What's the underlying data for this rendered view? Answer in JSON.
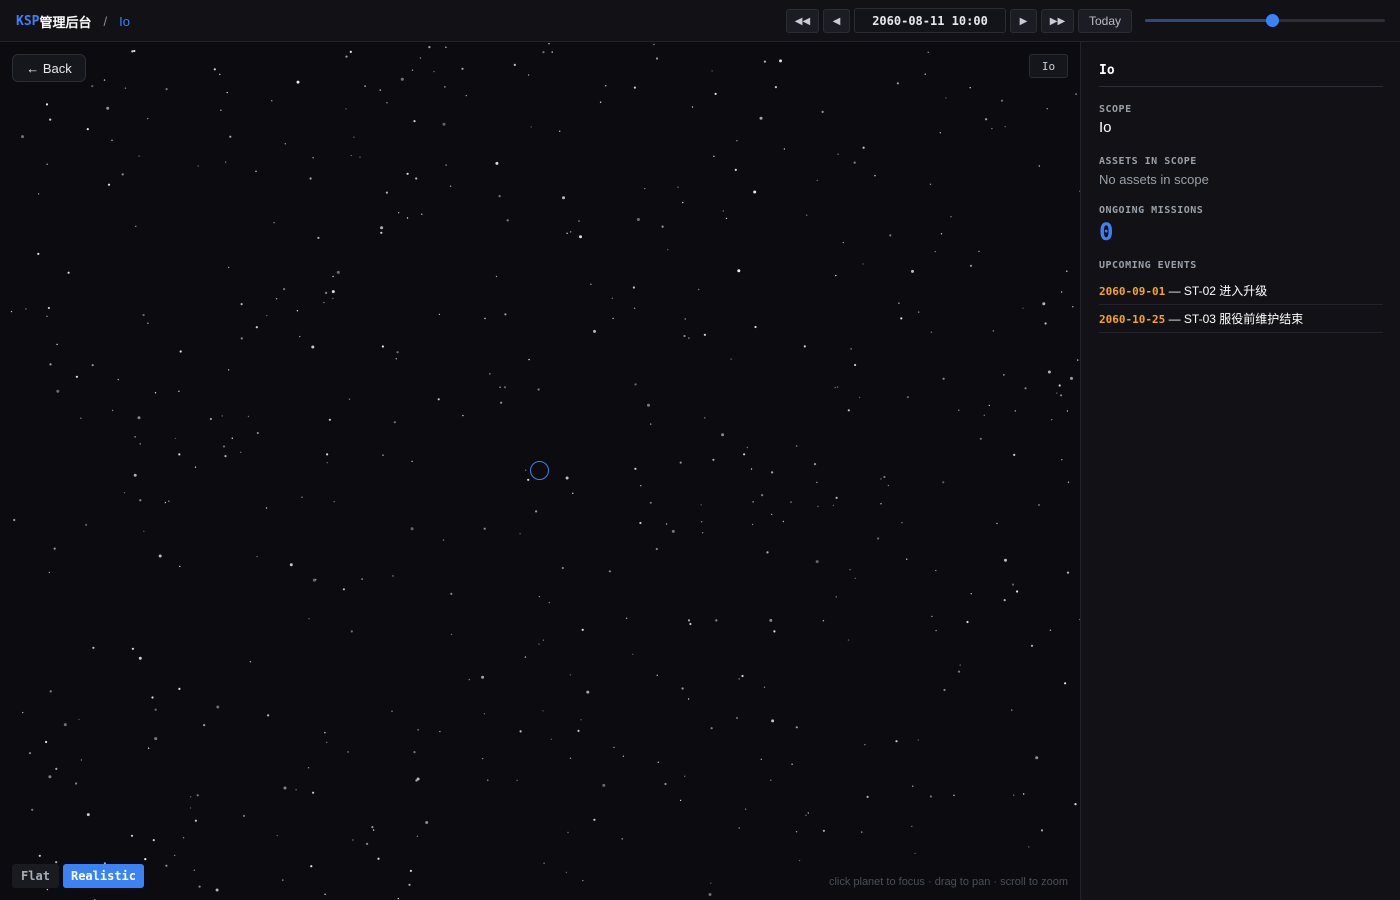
{
  "header": {
    "brand_prefix": "KSP",
    "brand_suffix": "管理后台",
    "separator": "/",
    "breadcrumb": "Io"
  },
  "timebar": {
    "rewind_fast_label": "◀◀",
    "step_back_label": "◀",
    "datetime": "2060-08-11 10:00",
    "step_forward_label": "▶",
    "forward_fast_label": "▶▶",
    "today_label": "Today",
    "slider_position": 0.53
  },
  "viewport": {
    "back_label": "← Back",
    "focus_label": "Io",
    "mode_flat_label": "Flat",
    "mode_realistic_label": "Realistic",
    "active_mode": "Realistic",
    "hint": "click planet to focus · drag to pan · scroll to zoom"
  },
  "panel": {
    "title": "Io",
    "scope_label": "SCOPE",
    "scope_value": "Io",
    "assets_label": "ASSETS IN SCOPE",
    "assets_value": "No assets in scope",
    "missions_label": "ONGOING MISSIONS",
    "missions_value": "0",
    "events_label": "UPCOMING EVENTS",
    "events": [
      {
        "date": "2060-09-01",
        "separator": " — ",
        "text": "ST-02 进入升级"
      },
      {
        "date": "2060-10-25",
        "separator": " — ",
        "text": "ST-03 服役前维护结束"
      }
    ]
  },
  "colors": {
    "accent": "#3b82f6",
    "event_date": "#f5a524",
    "background": "#0b0b10"
  }
}
